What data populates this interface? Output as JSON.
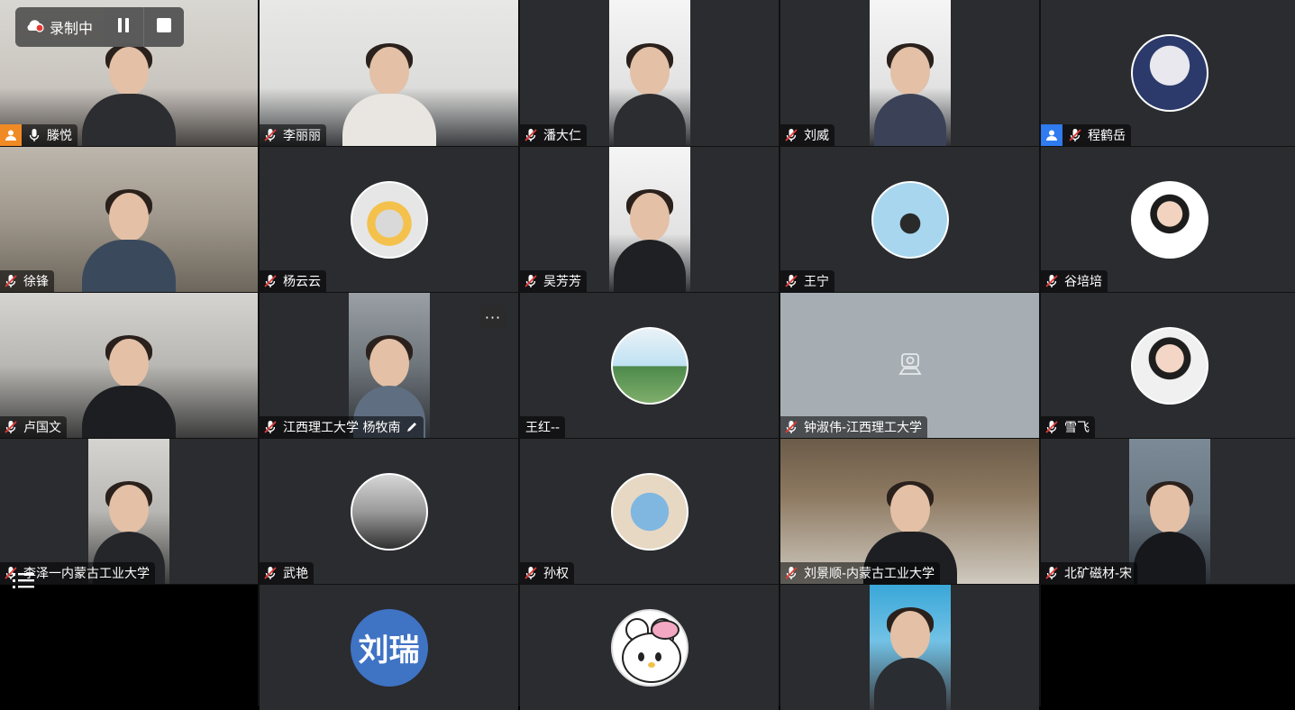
{
  "recording": {
    "status_label": "录制中"
  },
  "participants": [
    {
      "name": "滕悦",
      "badge": "orange",
      "mic": "on"
    },
    {
      "name": "李丽丽",
      "mic": "muted"
    },
    {
      "name": "潘大仁",
      "mic": "muted"
    },
    {
      "name": "刘威",
      "mic": "muted"
    },
    {
      "name": "程鹤岳",
      "badge": "blue",
      "mic": "muted"
    },
    {
      "name": "徐锋",
      "mic": "muted"
    },
    {
      "name": "杨云云",
      "mic": "muted"
    },
    {
      "name": "吴芳芳",
      "mic": "muted"
    },
    {
      "name": "王宁",
      "mic": "muted"
    },
    {
      "name": "谷培培",
      "mic": "muted"
    },
    {
      "name": "卢国文",
      "mic": "muted"
    },
    {
      "name": "江西理工大学 杨牧南",
      "mic": "muted"
    },
    {
      "name": "王红--"
    },
    {
      "name": "钟淑伟-江西理工大学",
      "mic": "muted"
    },
    {
      "name": "雪飞",
      "mic": "muted"
    },
    {
      "name": "李泽一内蒙古工业大学",
      "mic": "muted"
    },
    {
      "name": "武艳",
      "mic": "muted"
    },
    {
      "name": "孙权",
      "mic": "muted"
    },
    {
      "name": "刘景顺-内蒙古工业大学",
      "mic": "muted"
    },
    {
      "name": "北矿磁材-宋",
      "mic": "muted"
    }
  ],
  "avatar_texts": {
    "liu_rui": "刘瑞"
  },
  "more_menu": {
    "label": "···"
  }
}
